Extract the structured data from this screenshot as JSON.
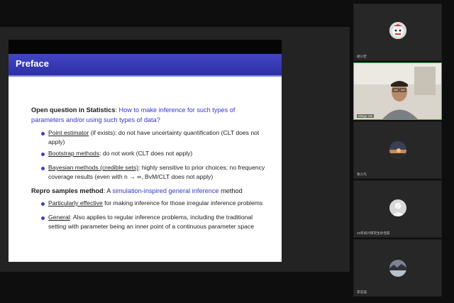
{
  "slide": {
    "title": "Preface",
    "q_label": "Open question in Statistics",
    "q_sep": ": ",
    "q_line1": "How to make inference for such types of",
    "q_line2": "parameters and/or using such types of data?",
    "b1": {
      "term": "Point estimator",
      "rest1": " (if exists): do not have uncertainty quantification (CLT does not",
      "rest2": "apply)"
    },
    "b2": {
      "term": "Bootstrap methods",
      "rest": ": do not work (CLT does not apply)"
    },
    "b3": {
      "term": "Bayesian methods (credible sets)",
      "rest1": ": highly sensitive to prior choices; no frequency",
      "rest2": "coverage results (even with n → ∞, BvM/CLT does not apply)"
    },
    "repro_label": "Repro samples method",
    "repro_sep": ": A ",
    "repro_hl": "simulation-inspired general inference",
    "repro_end": " method",
    "b4": {
      "term": "Particularly effective",
      "rest": " for making inference for those irregular inference problems"
    },
    "b5": {
      "term": "General",
      "rest1": ": Also applies to regular inference problems, including the traditional",
      "rest2": "setting with parameter being an inner point of a continuous parameter space"
    }
  },
  "participants": [
    {
      "name": "胡小宏",
      "avatar": "cartoon-avatar"
    },
    {
      "name": "Minge Xie",
      "avatar": "camera-video"
    },
    {
      "name": "张小凡",
      "avatar": "sunset-avatar"
    },
    {
      "name": "23年统计研究生孙佳茹",
      "avatar": "default-person-avatar"
    },
    {
      "name": "李志强",
      "avatar": "lake-avatar"
    }
  ],
  "colors": {
    "title_bar": "#3336b8",
    "accent_text": "#3638c8",
    "active_speaker": "#46b54b"
  }
}
